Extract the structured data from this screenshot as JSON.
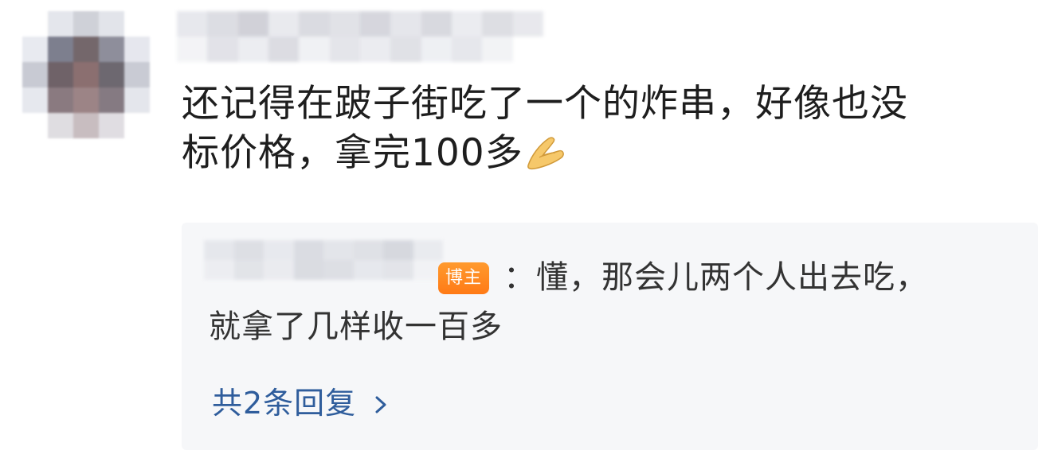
{
  "comment": {
    "line1": "还记得在跛子街吃了一个的炸串，好像也没",
    "line2": "标价格，拿完100多",
    "emoji_icon": "pinch-hand-icon"
  },
  "reply": {
    "author_badge": "博主",
    "separator": "：",
    "line1": "懂，那会儿两个人出去吃，",
    "line2": "就拿了几样收一百多"
  },
  "more_replies": {
    "label": "共2条回复",
    "icon": "chevron-right-icon"
  },
  "colors": {
    "link": "#2f5d9c",
    "badge": "#ff8a20",
    "reply_bg": "#f6f7f9",
    "text": "#1e1e1e"
  }
}
